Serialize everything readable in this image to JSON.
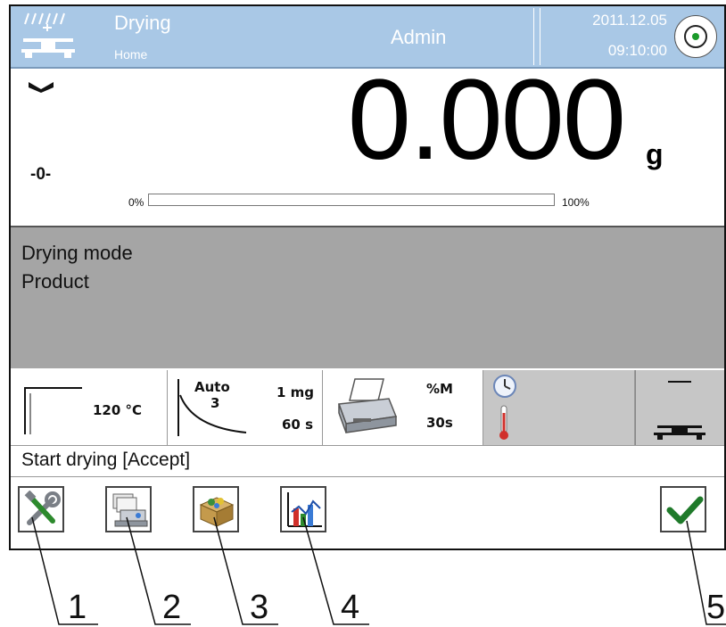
{
  "header": {
    "title": "Drying",
    "subtitle": "Home",
    "user": "Admin",
    "date": "2011.12.05",
    "time": "09:10:00"
  },
  "reading": {
    "zero_indicator": "-0-",
    "value": "0.000",
    "unit": "g",
    "progress": {
      "min_label": "0%",
      "max_label": "100%",
      "fraction": 0.0
    }
  },
  "info": {
    "mode": "Drying mode",
    "product": "Product"
  },
  "widgets": {
    "temperature": {
      "value": "120 °C"
    },
    "finish": {
      "mode": "Auto",
      "number": "3",
      "mass": "1 mg",
      "time": "60 s"
    },
    "printout": {
      "unit": "%M",
      "interval": "30s"
    }
  },
  "hint": "Start drying [Accept]",
  "toolbar": [
    {
      "icon": "tools-icon"
    },
    {
      "icon": "scale-database-icon"
    },
    {
      "icon": "product-box-icon"
    },
    {
      "icon": "chart-icon"
    },
    {
      "icon": "check-icon"
    }
  ],
  "callouts": [
    "1",
    "2",
    "3",
    "4",
    "5"
  ],
  "colors": {
    "header": "#a9c8e6",
    "info_panel": "#a5a5a5",
    "status_dot": "#1a9a2a",
    "accept": "#1f7a2a"
  }
}
